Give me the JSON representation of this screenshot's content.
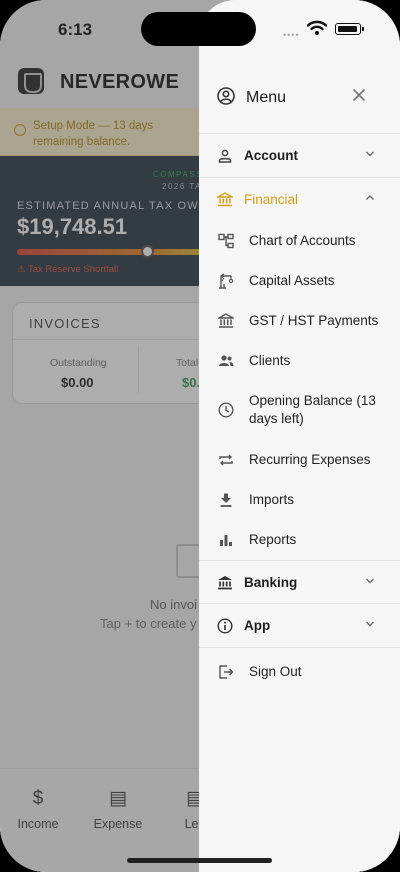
{
  "status": {
    "time": "6:13"
  },
  "app": {
    "brand": "NEVEROWE",
    "banner": "Setup Mode — 13 days remaining balance.",
    "tax": {
      "compass": "COMPASS",
      "year": "2026 TA",
      "label": "ESTIMATED ANNUAL TAX OWING",
      "amount": "$19,748.51",
      "warning": "⚠ Tax Reserve Shortfall"
    },
    "invoices": {
      "title": "INVOICES",
      "outstanding_label": "Outstanding",
      "outstanding_value": "$0.00",
      "total_label": "Total",
      "total_value": "$0."
    },
    "empty": {
      "title": "No invoi",
      "subtitle": "Tap + to create y"
    },
    "tabs": [
      {
        "label": "Income",
        "icon": "$"
      },
      {
        "label": "Expense",
        "icon": "▤"
      },
      {
        "label": "Led",
        "icon": "▤"
      }
    ]
  },
  "menu": {
    "title": "Menu",
    "sections": {
      "account": "Account",
      "financial": "Financial",
      "banking": "Banking",
      "app": "App"
    },
    "financial_items": [
      {
        "label": "Chart of Accounts",
        "icon": "hierarchy-icon"
      },
      {
        "label": "Capital Assets",
        "icon": "crane-icon"
      },
      {
        "label": "GST / HST Payments",
        "icon": "bank-icon"
      },
      {
        "label": "Clients",
        "icon": "people-icon"
      },
      {
        "label": "Opening Balance (13 days left)",
        "icon": "clock-icon"
      },
      {
        "label": "Recurring Expenses",
        "icon": "repeat-icon"
      },
      {
        "label": "Imports",
        "icon": "download-icon"
      },
      {
        "label": "Reports",
        "icon": "bar-chart-icon"
      }
    ],
    "sign_out": "Sign Out"
  },
  "colors": {
    "accent": "#d39d18",
    "tax_card": "#2d3b49",
    "banner": "#fbf0cf"
  }
}
